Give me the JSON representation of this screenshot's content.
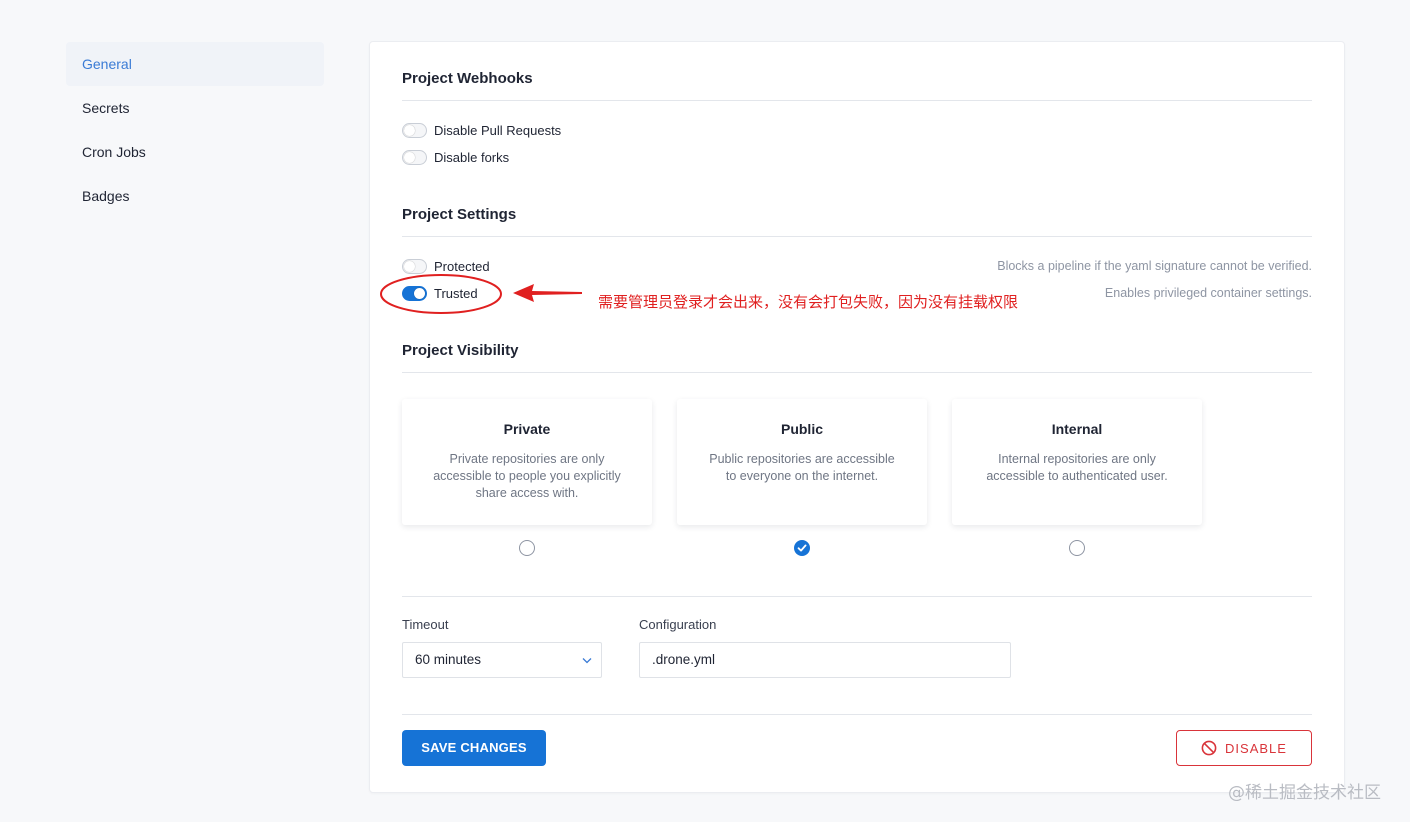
{
  "sidebar": {
    "items": [
      {
        "label": "General",
        "active": true
      },
      {
        "label": "Secrets",
        "active": false
      },
      {
        "label": "Cron Jobs",
        "active": false
      },
      {
        "label": "Badges",
        "active": false
      }
    ]
  },
  "webhooks": {
    "title": "Project Webhooks",
    "disable_pull_requests": {
      "label": "Disable Pull Requests",
      "on": false
    },
    "disable_forks": {
      "label": "Disable forks",
      "on": false
    }
  },
  "settings": {
    "title": "Project Settings",
    "protected": {
      "label": "Protected",
      "on": false,
      "hint": "Blocks a pipeline if the yaml signature cannot be verified."
    },
    "trusted": {
      "label": "Trusted",
      "on": true,
      "hint": "Enables privileged container settings."
    }
  },
  "visibility": {
    "title": "Project Visibility",
    "options": [
      {
        "title": "Private",
        "description": "Private repositories are only accessible to people you explicitly share access with.",
        "selected": false
      },
      {
        "title": "Public",
        "description": "Public repositories are accessible to everyone on the internet.",
        "selected": true
      },
      {
        "title": "Internal",
        "description": "Internal repositories are only accessible to authenticated user.",
        "selected": false
      }
    ]
  },
  "timeout": {
    "label": "Timeout",
    "value": "60 minutes"
  },
  "configuration": {
    "label": "Configuration",
    "value": ".drone.yml"
  },
  "buttons": {
    "save": "SAVE CHANGES",
    "disable": "DISABLE"
  },
  "annotation": {
    "text": "需要管理员登录才会出来，没有会打包失败，因为没有挂载权限"
  },
  "watermark": "@稀土掘金技术社区",
  "colors": {
    "accent": "#1673d6",
    "danger": "#d9343a",
    "annotation": "#e02020"
  }
}
